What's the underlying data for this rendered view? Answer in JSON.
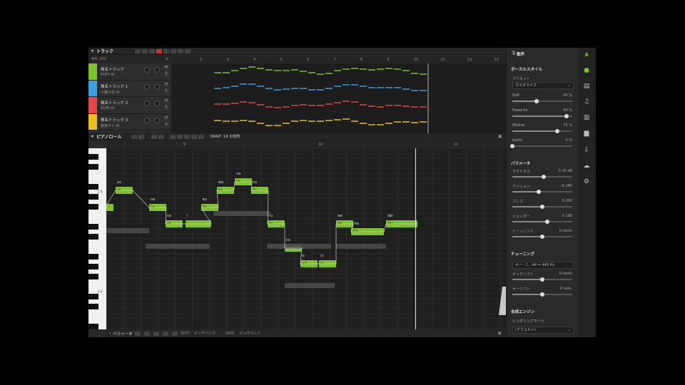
{
  "track_panel": {
    "title": "トラック",
    "time_sig": "4/4",
    "tempo": "103",
    "tracks": [
      {
        "name": "無名トラック",
        "voice": "POPY AI",
        "color": "#7cc22c"
      },
      {
        "name": "無名トラック 1",
        "voice": "小春六花 AI",
        "color": "#3aa0e0"
      },
      {
        "name": "無名トラック 2",
        "voice": "SUMI AI",
        "color": "#e04848"
      },
      {
        "name": "無名トラック 3",
        "voice": "夏色テト AI",
        "color": "#e8c020"
      }
    ],
    "ruler": [
      "2",
      "3",
      "4",
      "5",
      "6",
      "7",
      "8",
      "9",
      "10",
      "11",
      "12",
      "13"
    ]
  },
  "pianoroll": {
    "title": "ピアノロール",
    "snap_label": "SNAP",
    "snap_value": "16 分音符",
    "ruler": [
      "9",
      "10",
      "11"
    ],
    "key_labels": [
      "C5",
      "C4"
    ],
    "notes": [
      {
        "phoneme": "yo",
        "lyric": "yo"
      },
      {
        "phoneme": "na",
        "lyric": "na"
      },
      {
        "phoneme": "sa",
        "lyric": "sa"
      },
      {
        "phoneme": "i",
        "lyric": "i"
      },
      {
        "phoneme": "ko",
        "lyric": "ko"
      },
      {
        "phoneme": "wo",
        "lyric": "wo"
      },
      {
        "phoneme": "na",
        "lyric": "na"
      },
      {
        "phoneme": "hu",
        "lyric": "hu"
      },
      {
        "phoneme": "ru",
        "lyric": "ru"
      },
      {
        "phoneme": "ko",
        "lyric": "ko"
      },
      {
        "phoneme": "o:a",
        "lyric": "o:"
      },
      {
        "phoneme": "cl",
        "lyric": "cl"
      },
      {
        "phoneme": "wo",
        "lyric": "wo"
      },
      {
        "phoneme": "cho",
        "lyric": "cho"
      },
      {
        "phoneme": "dai",
        "lyric": "dai"
      }
    ]
  },
  "param_bar": {
    "title": "パラメータ",
    "edit_label": "EDIT:",
    "edit_value": "ピッチベンド",
    "disp_label": "DISP:",
    "disp_value": "ピッチベンド"
  },
  "right_panel": {
    "title": "歌声",
    "vocal_style": "ボーカルスタイル",
    "preset_label": "プリセット",
    "preset_value": "カスタマイズ",
    "styles": [
      {
        "name": "Soft",
        "value": "40 %",
        "level": 0.4
      },
      {
        "name": "Powerful",
        "value": "90 %",
        "level": 0.9
      },
      {
        "name": "Mellow",
        "value": "75 %",
        "level": 0.75
      },
      {
        "name": "Joyful",
        "value": "0 %",
        "level": 0.0
      }
    ],
    "params_title": "パラメータ",
    "params": [
      {
        "name": "ラウドネス",
        "value": "0.30 dB",
        "level": 0.52
      },
      {
        "name": "テンション",
        "value": "-0.180",
        "level": 0.44
      },
      {
        "name": "ブレス",
        "value": "0.000",
        "level": 0.5
      },
      {
        "name": "ジェンダー",
        "value": "0.190",
        "level": 0.58
      },
      {
        "name": "トーンシフト",
        "value": "0 cents",
        "level": 0.5
      }
    ],
    "tuning_title": "チューニング",
    "tuning_key": "キー：C、A4 = 440 Hz",
    "tuning": [
      {
        "name": "ピッチシフト",
        "value": "0 cents",
        "level": 0.5
      },
      {
        "name": "キーシフト",
        "value": "0 sem.",
        "level": 0.5
      }
    ],
    "engine_title": "合成エンジン",
    "render_label": "レンダリングモード",
    "render_value": "(デフォルト)"
  },
  "icons": [
    "logo-icon",
    "mic-icon",
    "clapper-icon",
    "music-note-icon",
    "library-icon",
    "book-icon",
    "export-icon",
    "cloud-icon",
    "gear-icon"
  ]
}
